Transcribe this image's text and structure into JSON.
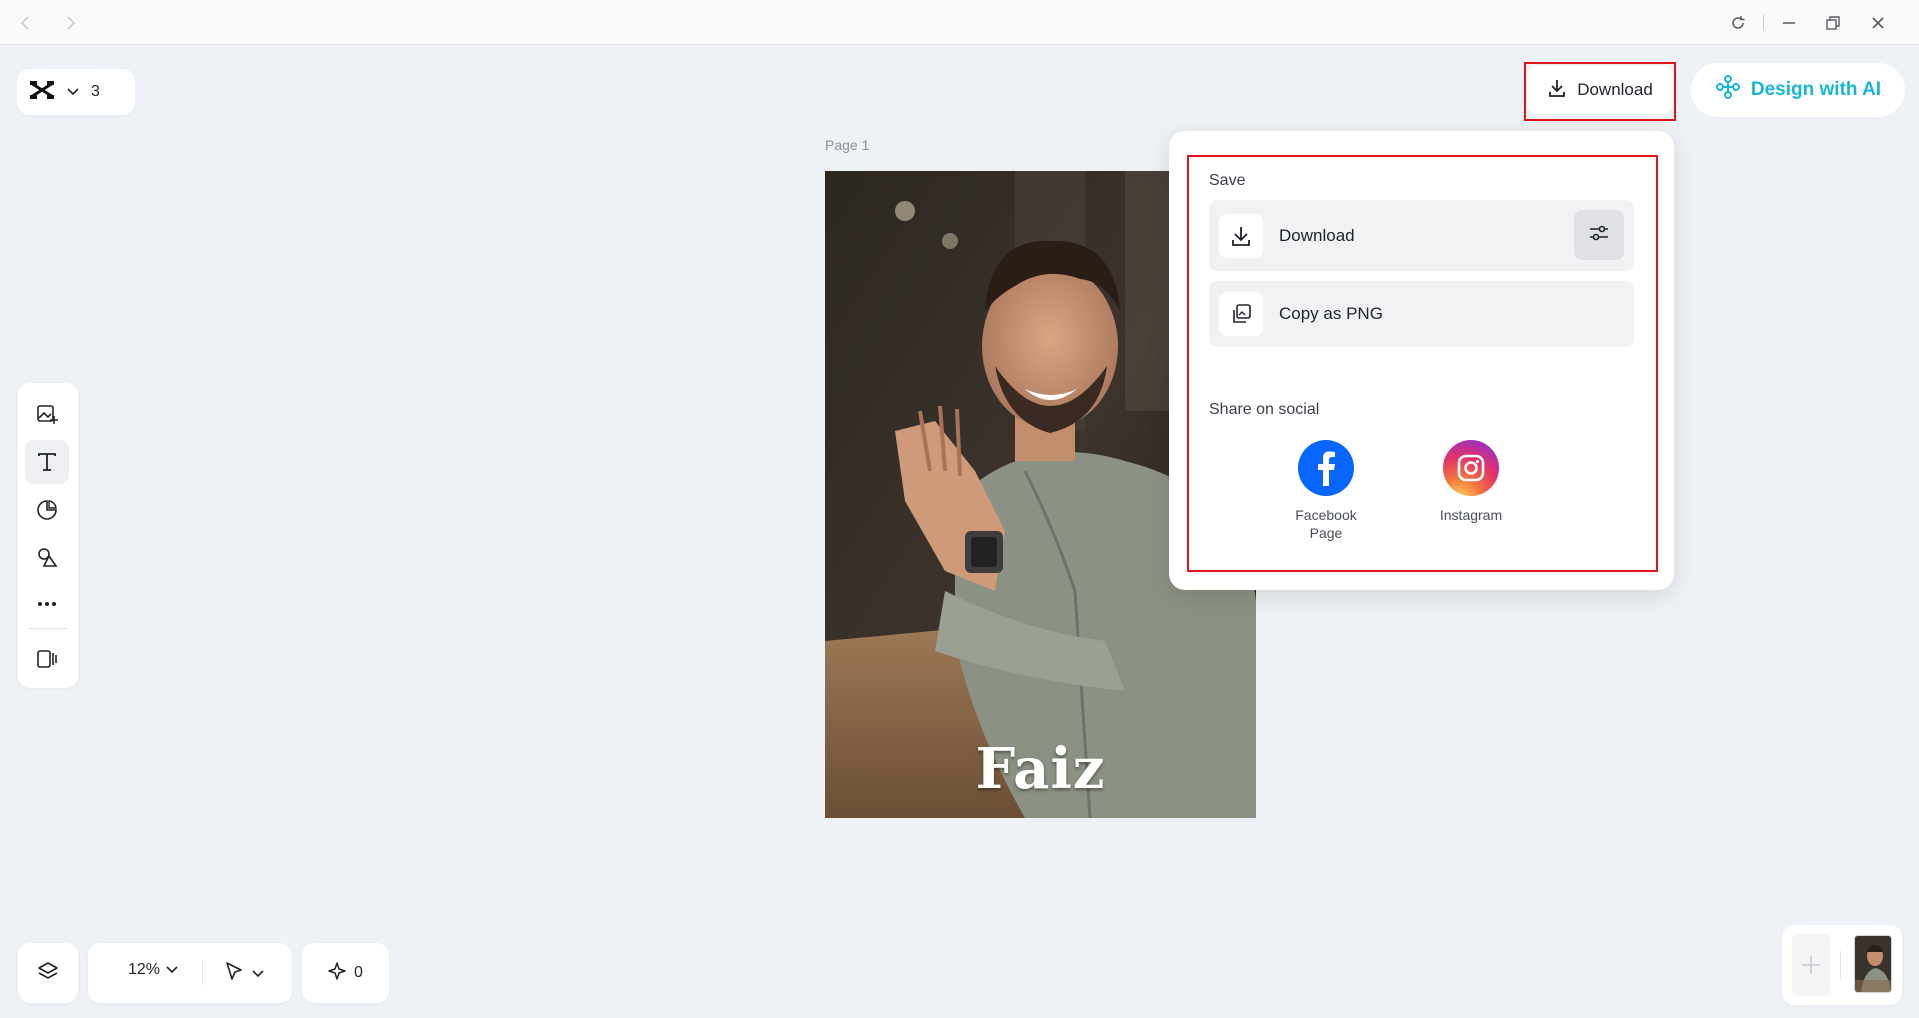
{
  "header": {
    "nav": [
      "back-icon",
      "forward-icon"
    ],
    "window_controls": [
      "refresh-icon",
      "minimize-icon",
      "restore-icon",
      "close-icon"
    ],
    "project_count": "3",
    "download_label": "Download",
    "design_ai_label": "Design with AI"
  },
  "canvas": {
    "page_label": "Page 1",
    "photo_text": "Faiz"
  },
  "toolbar": {
    "tools": [
      "add-image-icon",
      "text-icon",
      "sticker-icon",
      "shapes-icon",
      "more-icon",
      "brand-kit-icon"
    ],
    "active_tool": "text-icon"
  },
  "bottom": {
    "zoom": "12%",
    "ai_credits": "0"
  },
  "popup": {
    "save_title": "Save",
    "download_label": "Download",
    "copy_label": "Copy as PNG",
    "share_title": "Share on social",
    "social": [
      {
        "label": "Facebook Page",
        "color": "#0866ff"
      },
      {
        "label": "Instagram",
        "color": "#e1306c"
      }
    ]
  },
  "colors": {
    "accent": "#18b6d6",
    "highlight": "#e0141b",
    "canvas_bg": "#eef1f5"
  }
}
